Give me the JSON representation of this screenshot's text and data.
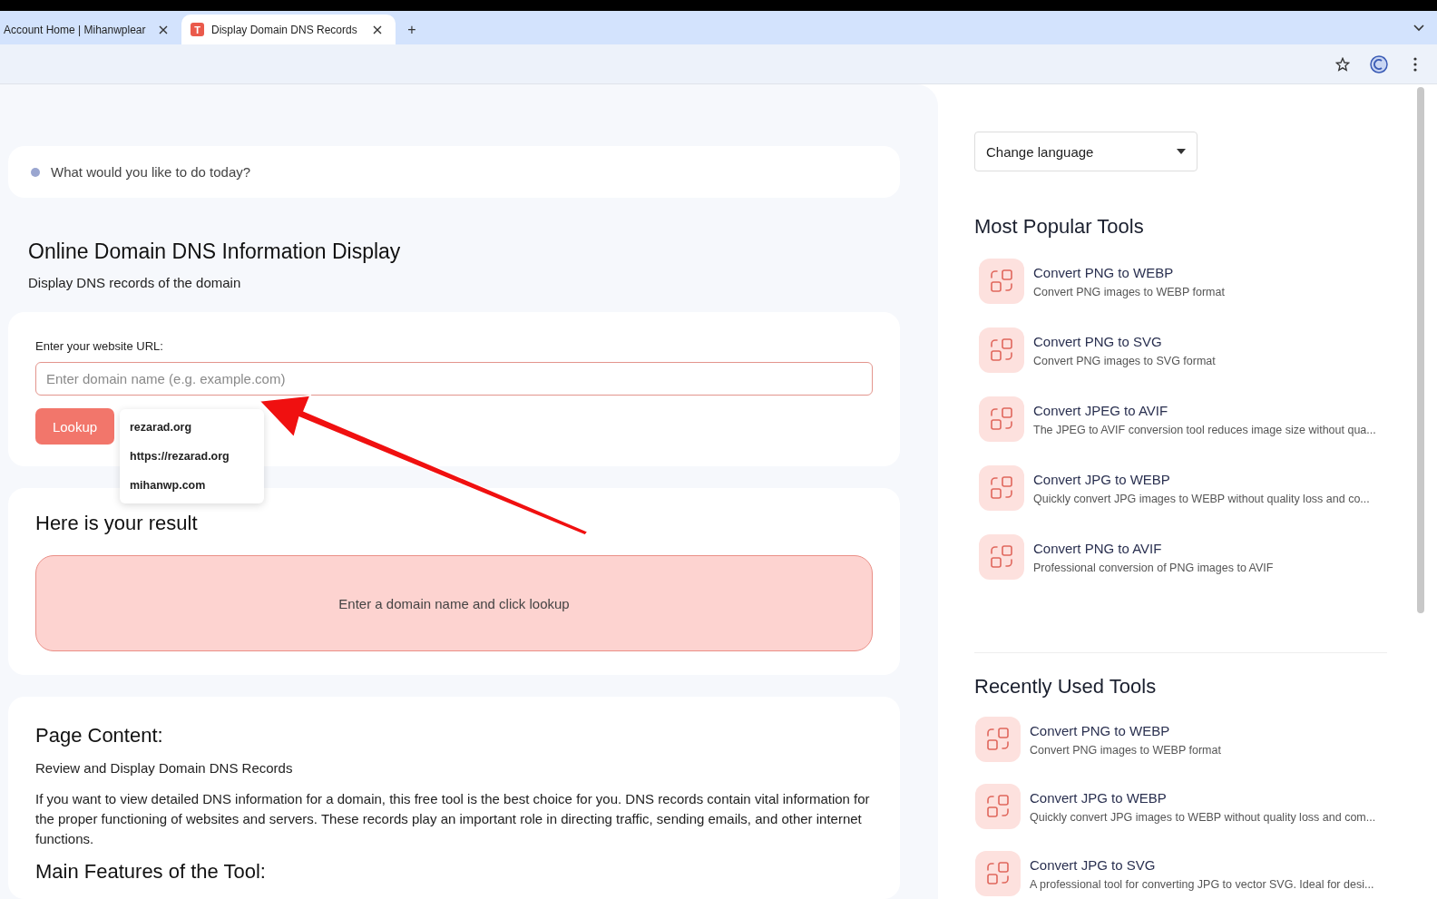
{
  "browser": {
    "tabs": [
      {
        "title": "Account Home | Mihanwplear",
        "selected": false
      },
      {
        "title": "Display Domain DNS Records",
        "selected": true,
        "favicon": "T"
      }
    ],
    "new_tab": "+"
  },
  "greeting": "What would you like to do today?",
  "tool": {
    "title": "Online Domain DNS Information Display",
    "subtitle": "Display DNS records of the domain"
  },
  "form": {
    "label": "Enter your website URL:",
    "placeholder": "Enter domain name (e.g. example.com)",
    "button": "Lookup",
    "suggestions": [
      "rezarad.org",
      "https://rezarad.org",
      "mihanwp.com"
    ]
  },
  "result": {
    "heading": "Here is your result",
    "message": "Enter a domain name and click lookup"
  },
  "content": {
    "heading": "Page Content:",
    "subheading": "Review and Display Domain DNS Records",
    "paragraph": "If you want to view detailed DNS information for a domain, this free tool is the best choice for you. DNS records contain vital information for the proper functioning of websites and servers. These records play an important role in directing traffic, sending emails, and other internet functions.",
    "next_heading": "Main Features of the Tool:"
  },
  "sidebar": {
    "language_select": "Change language",
    "popular": {
      "title": "Most Popular Tools",
      "items": [
        {
          "name": "Convert PNG to WEBP",
          "description": "Convert PNG images to WEBP format"
        },
        {
          "name": "Convert PNG to SVG",
          "description": "Convert PNG images to SVG format"
        },
        {
          "name": "Convert JPEG to AVIF",
          "description": "The JPEG to AVIF conversion tool reduces image size without qua..."
        },
        {
          "name": "Convert JPG to WEBP",
          "description": "Quickly convert JPG images to WEBP without quality loss and co..."
        },
        {
          "name": "Convert PNG to AVIF",
          "description": "Professional conversion of PNG images to AVIF"
        }
      ]
    },
    "recent": {
      "title": "Recently Used Tools",
      "items": [
        {
          "name": "Convert PNG to WEBP",
          "description": "Convert PNG images to WEBP format"
        },
        {
          "name": "Convert JPG to WEBP",
          "description": "Quickly convert JPG images to WEBP without quality loss and com..."
        },
        {
          "name": "Convert JPG to SVG",
          "description": "A professional tool for converting JPG to vector SVG. Ideal for desi..."
        }
      ]
    }
  }
}
